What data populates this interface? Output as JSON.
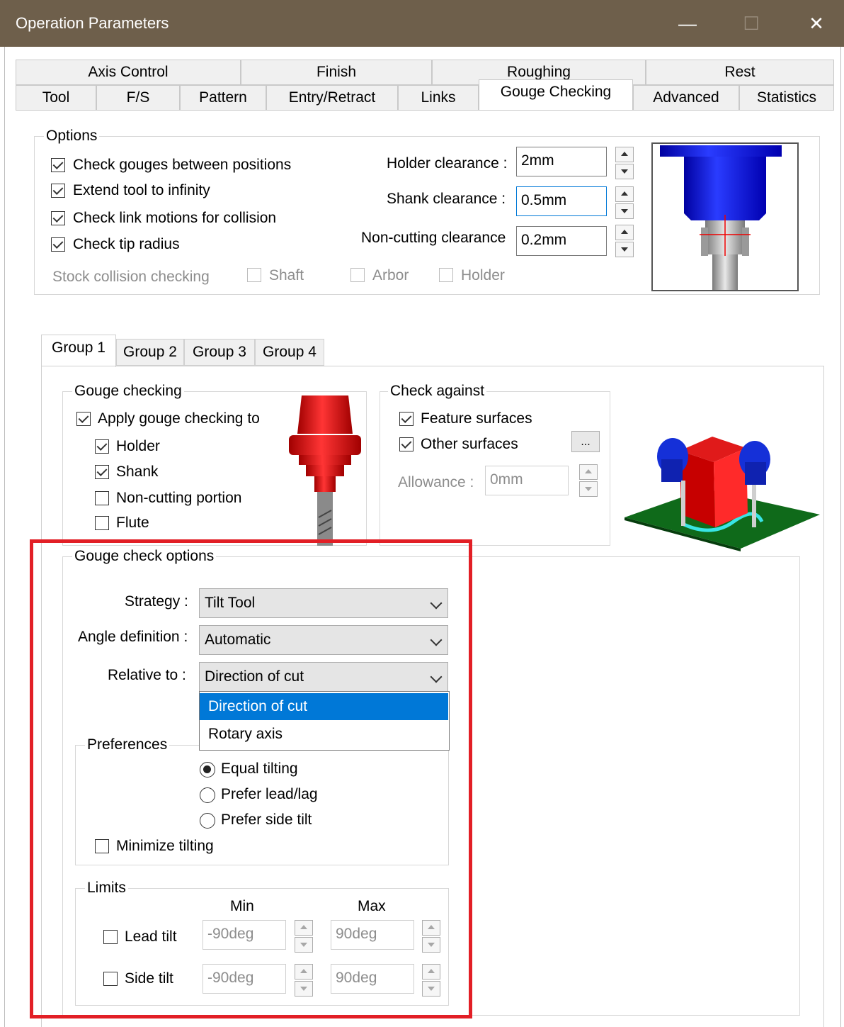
{
  "window": {
    "title": "Operation Parameters",
    "minimize": "—",
    "maximize": "☐",
    "close": "✕"
  },
  "tabs_back": [
    "Axis Control",
    "Finish",
    "Roughing",
    "Rest"
  ],
  "tabs_front": [
    "Tool",
    "F/S",
    "Pattern",
    "Entry/Retract",
    "Links",
    "Gouge Checking",
    "Advanced",
    "Statistics"
  ],
  "options": {
    "legend": "Options",
    "check_gouges": "Check gouges between positions",
    "extend_tool": "Extend tool to infinity",
    "check_link": "Check link motions for collision",
    "check_tip": "Check tip radius",
    "stock_collision": "Stock collision checking",
    "shaft": "Shaft",
    "arbor": "Arbor",
    "holder": "Holder",
    "holder_clearance_label": "Holder clearance :",
    "holder_clearance_value": "2mm",
    "shank_clearance_label": "Shank clearance :",
    "shank_clearance_value": "0.5mm",
    "noncut_clearance_label": "Non-cutting clearance",
    "noncut_clearance_value": "0.2mm"
  },
  "group_tabs": [
    "Group 1",
    "Group 2",
    "Group 3",
    "Group 4"
  ],
  "gouge_checking": {
    "legend": "Gouge checking",
    "apply": "Apply gouge checking to",
    "holder": "Holder",
    "shank": "Shank",
    "noncutting": "Non-cutting portion",
    "flute": "Flute"
  },
  "check_against": {
    "legend": "Check against",
    "feature": "Feature surfaces",
    "other": "Other surfaces",
    "more_button": "...",
    "allowance_label": "Allowance :",
    "allowance_value": "0mm"
  },
  "gouge_options": {
    "legend": "Gouge check options",
    "strategy_label": "Strategy :",
    "strategy_value": "Tilt Tool",
    "angle_label": "Angle definition :",
    "angle_value": "Automatic",
    "relative_label": "Relative to :",
    "relative_value": "Direction of cut",
    "relative_options": [
      "Direction of cut",
      "Rotary axis"
    ]
  },
  "preferences": {
    "legend": "Preferences",
    "equal": "Equal tilting",
    "lead": "Prefer lead/lag",
    "side": "Prefer side tilt",
    "minimize": "Minimize tilting"
  },
  "limits": {
    "legend": "Limits",
    "min": "Min",
    "max": "Max",
    "lead_tilt": "Lead tilt",
    "side_tilt": "Side tilt",
    "lead_min": "-90deg",
    "lead_max": "90deg",
    "side_min": "-90deg",
    "side_max": "90deg"
  },
  "colors": {
    "titlebar": "#6e5f4b",
    "highlight_box": "#e21f26",
    "selection": "#0078d7"
  }
}
